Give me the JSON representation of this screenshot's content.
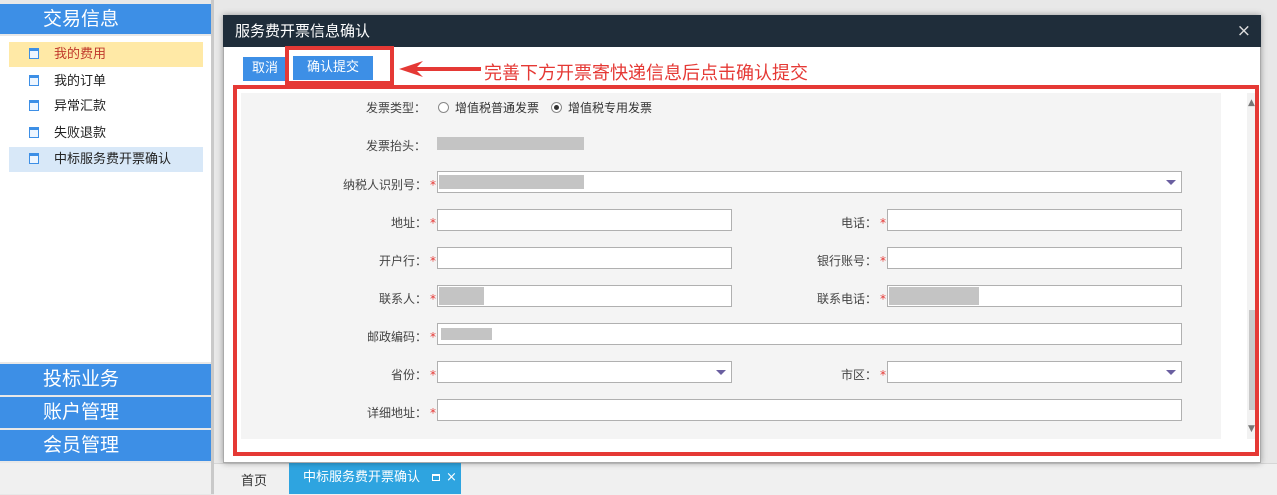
{
  "sidebar": {
    "sections": [
      "交易信息",
      "投标业务",
      "账户管理",
      "会员管理"
    ],
    "items": [
      {
        "label": "我的费用"
      },
      {
        "label": "我的订单"
      },
      {
        "label": "异常汇款"
      },
      {
        "label": "失败退款"
      },
      {
        "label": "中标服务费开票确认"
      }
    ]
  },
  "tabs": {
    "home": "首页",
    "active": "中标服务费开票确认",
    "close": "×"
  },
  "dialog": {
    "title": "服务费开票信息确认",
    "close": "×",
    "cancel_label": "取消",
    "submit_label": "确认提交",
    "annotation": "完善下方开票寄快递信息后点击确认提交"
  },
  "form": {
    "invoice_type_label": "发票类型：",
    "invoice_type_options": [
      "增值税普通发票",
      "增值税专用发票"
    ],
    "invoice_type_selected": "增值税专用发票",
    "invoice_title_label": "发票抬头：",
    "taxpayer_id_label": "纳税人识别号：",
    "address_label": "地址：",
    "phone_label": "电话：",
    "bank_label": "开户行：",
    "bank_account_label": "银行账号：",
    "contact_label": "联系人：",
    "contact_phone_label": "联系电话：",
    "postal_code_label": "邮政编码：",
    "province_label": "省份：",
    "city_label": "市区：",
    "detail_address_label": "详细地址：",
    "required_mark": "*"
  },
  "colors": {
    "accent": "#3d8fe6",
    "title_bar": "#1f2d3a",
    "annotation_red": "#e53935",
    "active_tab": "#2ea4e0"
  }
}
